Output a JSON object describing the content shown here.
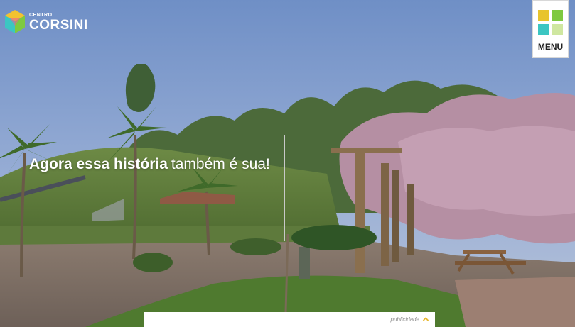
{
  "brand": {
    "small": "CENTRO",
    "name": "CORSINI"
  },
  "menu": {
    "label": "MENU",
    "colors": [
      "#e8c42c",
      "#7ec940",
      "#3cc6c2",
      "#cfe7a0"
    ]
  },
  "hero": {
    "headline_bold": "Agora essa história",
    "headline_light": "também é sua!"
  },
  "ad": {
    "label": "publicidade",
    "icon": "chevron-up-icon"
  },
  "icons": {
    "logo": "corsini-logo-icon",
    "menu": "menu-grid-icon"
  }
}
